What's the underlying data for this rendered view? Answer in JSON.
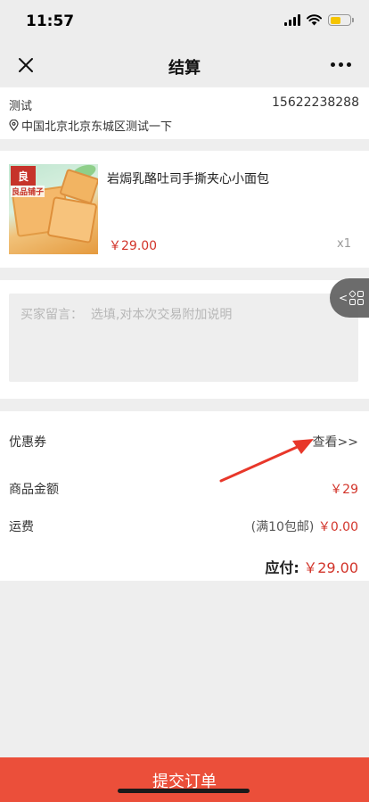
{
  "status": {
    "time": "11:57"
  },
  "nav": {
    "title": "结算"
  },
  "address": {
    "name": "测试",
    "phone": "15622238288",
    "line": "中国北京北京东城区测试一下"
  },
  "product": {
    "brand_logo": "良",
    "brand_text": "良品铺子",
    "title": "岩焗乳酪吐司手撕夹心小面包",
    "price": "￥29.00",
    "quantity": "x1"
  },
  "message": {
    "placeholder": "买家留言：  选填,对本次交易附加说明"
  },
  "summary": {
    "coupon_label": "优惠券",
    "coupon_link": "查看>>",
    "goods_amount_label": "商品金额",
    "goods_amount_value": "￥29",
    "shipping_label": "运费",
    "shipping_note": "(满10包邮)",
    "shipping_value": "￥0.00",
    "payable_label": "应付:",
    "payable_value": "￥29.00"
  },
  "footer": {
    "submit_label": "提交订单"
  },
  "colors": {
    "accent_red": "#d2342a",
    "submit_bg": "#eb4f3a",
    "battery": "#f5c400"
  }
}
